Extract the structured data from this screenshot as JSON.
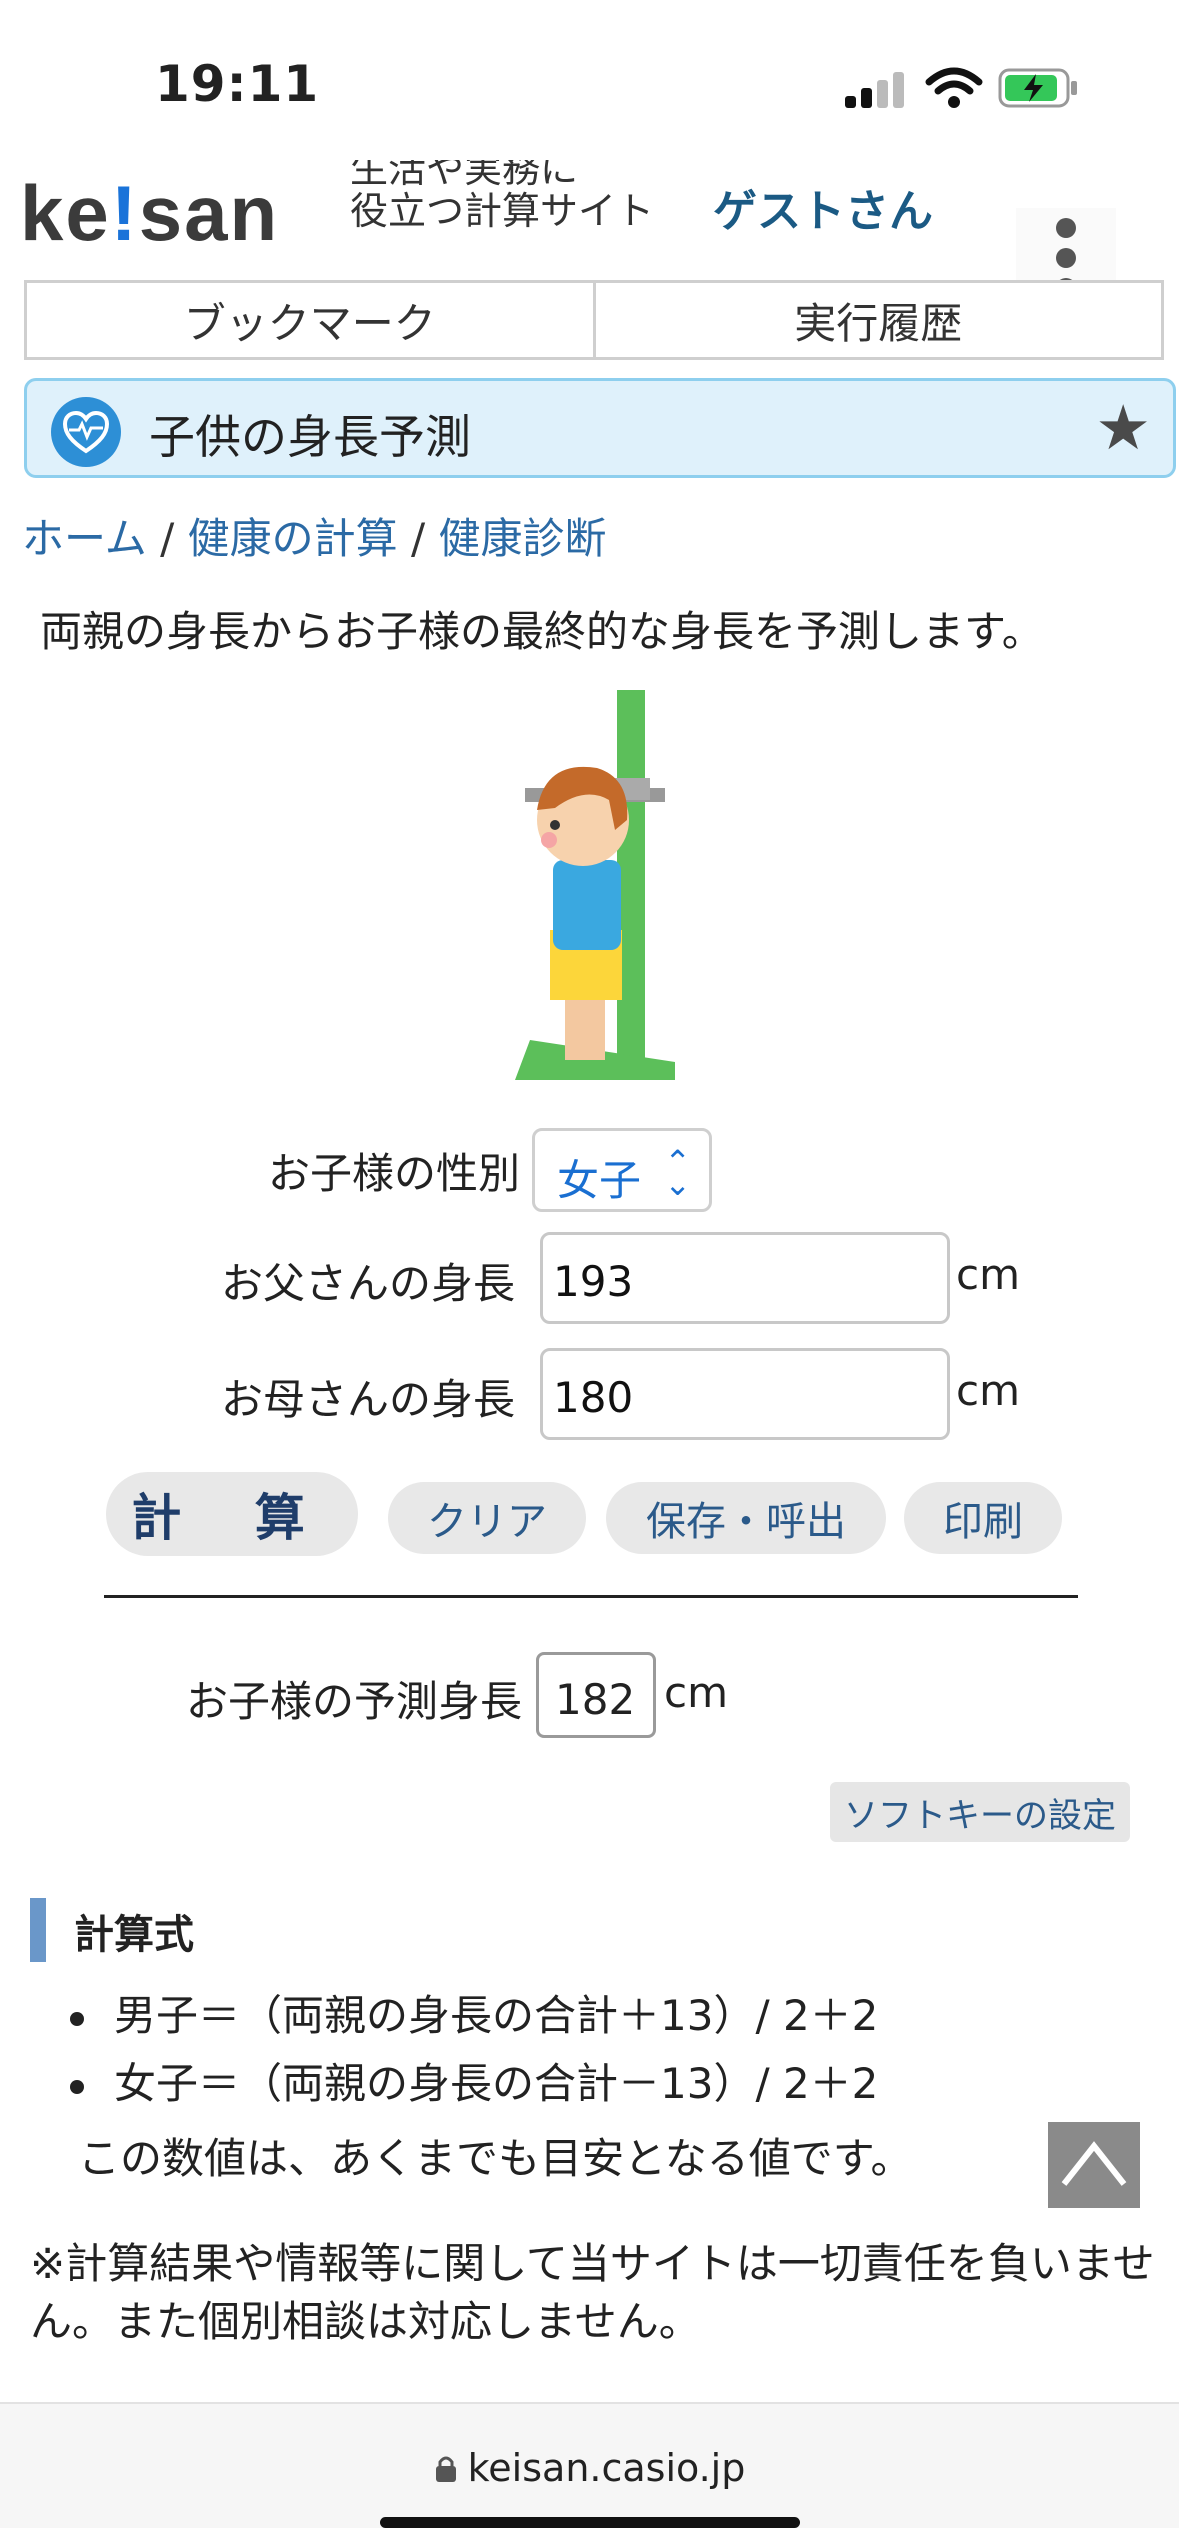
{
  "status": {
    "time": "19:11"
  },
  "header": {
    "logo": "ke!san",
    "logo_parts": [
      "ke",
      "!",
      "san"
    ],
    "tagline_line1": "生活や実務に",
    "tagline_line2": "役立つ計算サイト",
    "user": "ゲストさん"
  },
  "tabs": [
    {
      "label": "ブックマーク"
    },
    {
      "label": "実行履歴"
    }
  ],
  "page": {
    "title": "子供の身長予測"
  },
  "breadcrumb": {
    "home": "ホーム",
    "sep1": " / ",
    "level1": "健康の計算",
    "sep2": " / ",
    "level2": "健康診断"
  },
  "intro": "両親の身長からお子様の最終的な身長を予測します。",
  "form": {
    "gender_label": "お子様の性別",
    "gender_value": "女子",
    "father_label": "お父さんの身長",
    "father_value": "193",
    "mother_label": "お母さんの身長",
    "mother_value": "180",
    "unit": "cm"
  },
  "buttons": {
    "calc": "計 算",
    "clear": "クリア",
    "save": "保存・呼出",
    "print": "印刷"
  },
  "result": {
    "label": "お子様の予測身長",
    "value": "182",
    "unit": "cm"
  },
  "softkey": "ソフトキーの設定",
  "formula": {
    "heading": "計算式",
    "items": [
      "男子＝（両親の身長の合計＋13）/ 2＋2",
      "女子＝（両親の身長の合計－13）/ 2＋2"
    ],
    "note": "この数値は、あくまでも目安となる値です。"
  },
  "disclaimer": "※計算結果や情報等に関して当サイトは一切責任を負いません。また個別相談は対応しません。",
  "browser": {
    "url": "keisan.casio.jp"
  },
  "colors": {
    "accent": "#2b6aa5",
    "title_bg": "#dff1fb",
    "logo_dot": "#1a73d9",
    "battery": "#34c759"
  },
  "icons": [
    "signal-icon",
    "wifi-icon",
    "battery-icon",
    "kebab-menu-icon",
    "heart-health-icon",
    "star-icon",
    "chevron-updown-icon",
    "back-to-top-icon",
    "lock-icon"
  ]
}
